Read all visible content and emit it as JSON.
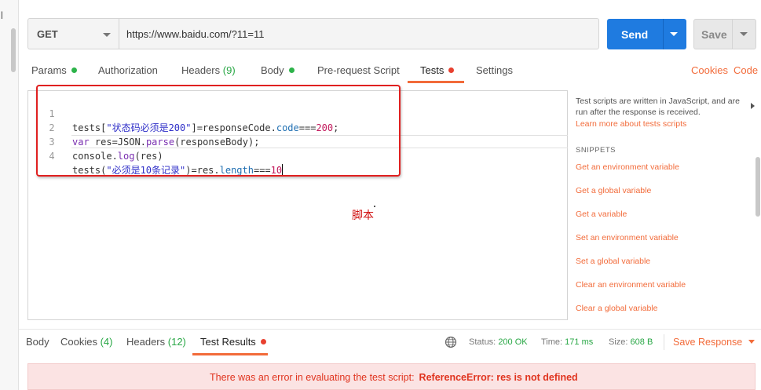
{
  "sidebar": {
    "letter": "l"
  },
  "request": {
    "method": "GET",
    "url": "https://www.baidu.com/?11=11",
    "send_label": "Send",
    "save_label": "Save"
  },
  "request_tabs": {
    "params": "Params",
    "authorization": "Authorization",
    "headers": "Headers",
    "headers_count": "(9)",
    "body": "Body",
    "prerequest": "Pre-request Script",
    "tests": "Tests",
    "settings": "Settings",
    "active": "Tests"
  },
  "links": {
    "cookies": "Cookies",
    "code": "Code"
  },
  "editor": {
    "line_numbers": [
      "1",
      "2",
      "3",
      "4"
    ],
    "lines": [
      "tests[\"状态码必须是200\"]=responseCode.code===200;",
      "var res=JSON.parse(responseBody);",
      "console.log(res)",
      "tests(\"必须是10条记录\")=res.length===10"
    ]
  },
  "annotation": {
    "label": "脚本",
    "color": "#e02020"
  },
  "side_panel": {
    "description": "Test scripts are written in JavaScript, and are run after the response is received.",
    "learn_more": "Learn more about tests scripts",
    "snippets_heading": "SNIPPETS",
    "snippets": [
      "Get an environment variable",
      "Get a global variable",
      "Get a variable",
      "Set an environment variable",
      "Set a global variable",
      "Clear an environment variable",
      "Clear a global variable"
    ]
  },
  "response_tabs": {
    "body": "Body",
    "cookies": "Cookies",
    "cookies_count": "(4)",
    "headers": "Headers",
    "headers_count": "(12)",
    "test_results": "Test Results",
    "active": "Test Results"
  },
  "response_status": {
    "status_label": "Status:",
    "status_value": "200 OK",
    "time_label": "Time:",
    "time_value": "171 ms",
    "size_label": "Size:",
    "size_value": "608 B",
    "save_response": "Save Response"
  },
  "error": {
    "message": "There was an error in evaluating the test script:",
    "detail": "ReferenceError: res is not defined"
  },
  "colors": {
    "accent": "#f26b3a",
    "send": "#1f7be0",
    "status_ok": "#28a745",
    "error_text": "#e0341f",
    "error_bg": "#fbe3e3"
  }
}
